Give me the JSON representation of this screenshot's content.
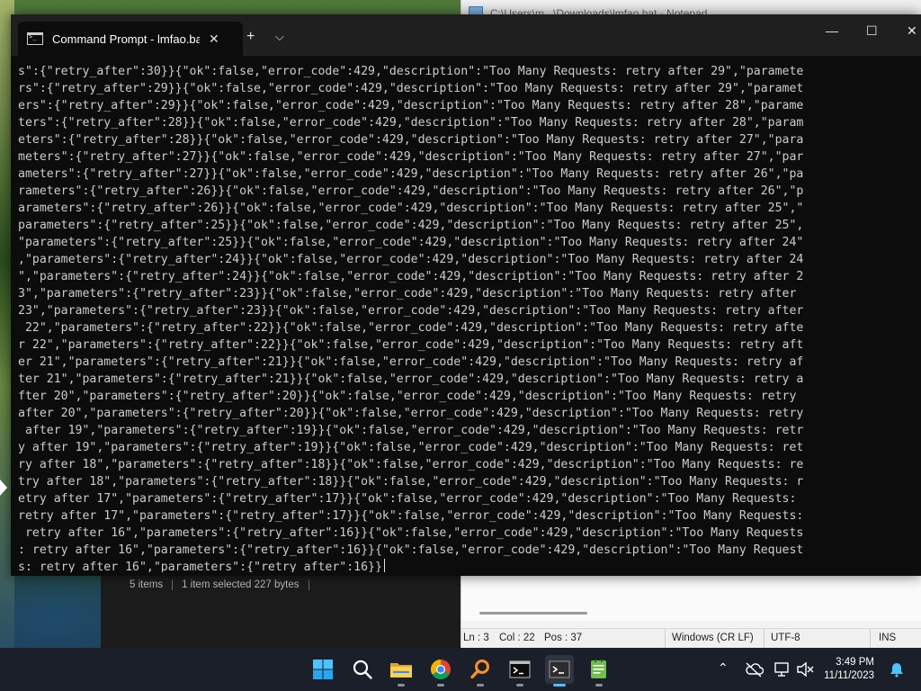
{
  "terminal": {
    "tab_title": "Command Prompt - lmfao.bat",
    "tab_close": "✕",
    "new_tab": "+",
    "tab_dropdown": "⌵",
    "minimize": "—",
    "maximize": "☐",
    "close": "✕",
    "lines": [
      "s\":{\"retry_after\":30}}{\"ok\":false,\"error_code\":429,\"description\":\"Too Many Requests: retry after 29\",\"paramete",
      "rs\":{\"retry_after\":29}}{\"ok\":false,\"error_code\":429,\"description\":\"Too Many Requests: retry after 29\",\"paramet",
      "ers\":{\"retry_after\":29}}{\"ok\":false,\"error_code\":429,\"description\":\"Too Many Requests: retry after 28\",\"parame",
      "ters\":{\"retry_after\":28}}{\"ok\":false,\"error_code\":429,\"description\":\"Too Many Requests: retry after 28\",\"param",
      "eters\":{\"retry_after\":28}}{\"ok\":false,\"error_code\":429,\"description\":\"Too Many Requests: retry after 27\",\"para",
      "meters\":{\"retry_after\":27}}{\"ok\":false,\"error_code\":429,\"description\":\"Too Many Requests: retry after 27\",\"par",
      "ameters\":{\"retry_after\":27}}{\"ok\":false,\"error_code\":429,\"description\":\"Too Many Requests: retry after 26\",\"pa",
      "rameters\":{\"retry_after\":26}}{\"ok\":false,\"error_code\":429,\"description\":\"Too Many Requests: retry after 26\",\"p",
      "arameters\":{\"retry_after\":26}}{\"ok\":false,\"error_code\":429,\"description\":\"Too Many Requests: retry after 25\",\"",
      "parameters\":{\"retry_after\":25}}{\"ok\":false,\"error_code\":429,\"description\":\"Too Many Requests: retry after 25\",",
      "\"parameters\":{\"retry_after\":25}}{\"ok\":false,\"error_code\":429,\"description\":\"Too Many Requests: retry after 24\"",
      ",\"parameters\":{\"retry_after\":24}}{\"ok\":false,\"error_code\":429,\"description\":\"Too Many Requests: retry after 24",
      "\",\"parameters\":{\"retry_after\":24}}{\"ok\":false,\"error_code\":429,\"description\":\"Too Many Requests: retry after 2",
      "3\",\"parameters\":{\"retry_after\":23}}{\"ok\":false,\"error_code\":429,\"description\":\"Too Many Requests: retry after ",
      "23\",\"parameters\":{\"retry_after\":23}}{\"ok\":false,\"error_code\":429,\"description\":\"Too Many Requests: retry after",
      " 22\",\"parameters\":{\"retry_after\":22}}{\"ok\":false,\"error_code\":429,\"description\":\"Too Many Requests: retry afte",
      "r 22\",\"parameters\":{\"retry_after\":22}}{\"ok\":false,\"error_code\":429,\"description\":\"Too Many Requests: retry aft",
      "er 21\",\"parameters\":{\"retry_after\":21}}{\"ok\":false,\"error_code\":429,\"description\":\"Too Many Requests: retry af",
      "ter 21\",\"parameters\":{\"retry_after\":21}}{\"ok\":false,\"error_code\":429,\"description\":\"Too Many Requests: retry a",
      "fter 20\",\"parameters\":{\"retry_after\":20}}{\"ok\":false,\"error_code\":429,\"description\":\"Too Many Requests: retry ",
      "after 20\",\"parameters\":{\"retry_after\":20}}{\"ok\":false,\"error_code\":429,\"description\":\"Too Many Requests: retry",
      " after 19\",\"parameters\":{\"retry_after\":19}}{\"ok\":false,\"error_code\":429,\"description\":\"Too Many Requests: retr",
      "y after 19\",\"parameters\":{\"retry_after\":19}}{\"ok\":false,\"error_code\":429,\"description\":\"Too Many Requests: ret",
      "ry after 18\",\"parameters\":{\"retry_after\":18}}{\"ok\":false,\"error_code\":429,\"description\":\"Too Many Requests: re",
      "try after 18\",\"parameters\":{\"retry_after\":18}}{\"ok\":false,\"error_code\":429,\"description\":\"Too Many Requests: r",
      "etry after 17\",\"parameters\":{\"retry_after\":17}}{\"ok\":false,\"error_code\":429,\"description\":\"Too Many Requests: ",
      "retry after 17\",\"parameters\":{\"retry_after\":17}}{\"ok\":false,\"error_code\":429,\"description\":\"Too Many Requests:",
      " retry after 16\",\"parameters\":{\"retry_after\":16}}{\"ok\":false,\"error_code\":429,\"description\":\"Too Many Requests",
      ": retry after 16\",\"parameters\":{\"retry_after\":16}}{\"ok\":false,\"error_code\":429,\"description\":\"Too Many Request",
      "s: retry after 16\",\"parameters\":{\"retry_after\":16}}"
    ]
  },
  "notepad": {
    "title": "C:\\Users\\m...\\Downloads\\lmfao.bat - Notepad",
    "status": {
      "position": "Ln : 3",
      "column": "Col : 22",
      "pos": "Pos : 37",
      "line_ending": "Windows (CR LF)",
      "encoding": "UTF-8",
      "insert_mode": "INS"
    }
  },
  "explorer": {
    "item_count": "5 items",
    "selection": "1 item selected  227 bytes"
  },
  "taskbar": {
    "apps": [
      {
        "name": "start",
        "icon": "windows-logo-icon"
      },
      {
        "name": "search",
        "icon": "search-icon"
      },
      {
        "name": "file-explorer",
        "icon": "folder-icon"
      },
      {
        "name": "chrome",
        "icon": "chrome-icon"
      },
      {
        "name": "search-tool",
        "icon": "magnifier-orange-icon"
      },
      {
        "name": "command-prompt",
        "icon": "cmd-icon"
      },
      {
        "name": "terminal",
        "icon": "terminal-icon",
        "active": true
      },
      {
        "name": "notepad",
        "icon": "notepad-icon"
      }
    ],
    "tray": {
      "overflow": "⌃",
      "time": "3:49 PM",
      "date": "11/11/2023"
    }
  },
  "colors": {
    "terminal_bg": "#0c0c0c",
    "terminal_text": "#cccccc",
    "titlebar_bg": "#1f1f1f",
    "taskbar_bg": "#1a1f29",
    "accent": "#4cc2ff"
  }
}
